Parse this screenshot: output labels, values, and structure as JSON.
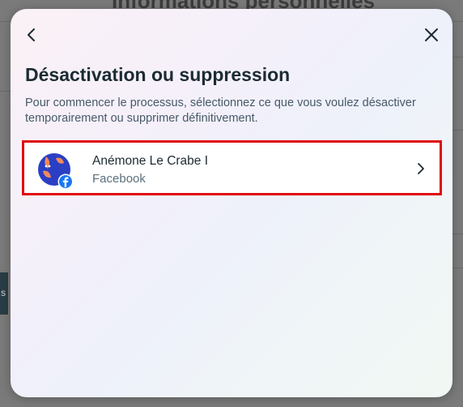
{
  "background": {
    "title": "Informations personnelles",
    "side_tab_label": "s"
  },
  "modal": {
    "title": "Désactivation ou suppression",
    "description": "Pour commencer le processus, sélectionnez ce que vous voulez désactiver temporairement ou supprimer définitivement.",
    "back_icon": "chevron-left-icon",
    "close_icon": "close-icon",
    "account": {
      "name": "Anémone Le Crabe I",
      "platform": "Facebook",
      "badge_icon": "facebook-icon",
      "chevron_icon": "chevron-right-icon"
    }
  },
  "colors": {
    "highlight_border": "#e0080f",
    "title_text": "#1c2b33",
    "facebook_blue": "#1877f2",
    "avatar_bg": "#2b3fc4",
    "avatar_accent": "#f08a5d"
  }
}
